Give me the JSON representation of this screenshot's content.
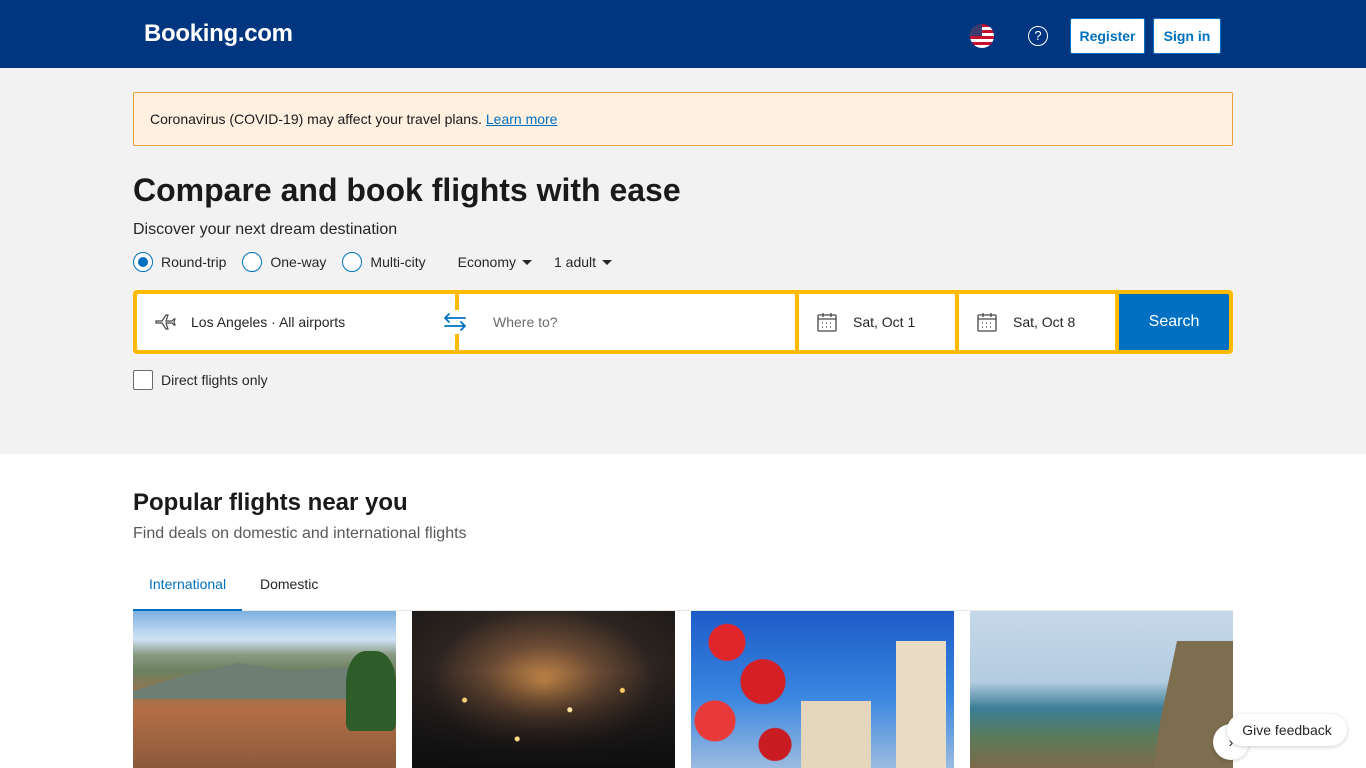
{
  "header": {
    "logo": "Booking.com",
    "help_glyph": "?",
    "register_label": "Register",
    "signin_label": "Sign in",
    "flag_icon": "us-flag-icon",
    "help_icon": "help-circle-icon"
  },
  "alert": {
    "text": "Coronavirus (COVID-19) may affect your travel plans.",
    "link": "Learn more"
  },
  "hero": {
    "title": "Compare and book flights with ease",
    "subtitle": "Discover your next dream destination"
  },
  "trip_options": {
    "types": [
      {
        "label": "Round-trip",
        "selected": true
      },
      {
        "label": "One-way",
        "selected": false
      },
      {
        "label": "Multi-city",
        "selected": false
      }
    ],
    "cabin": "Economy",
    "travelers": "1 adult"
  },
  "search": {
    "from": "Los Angeles · All airports",
    "to_placeholder": "Where to?",
    "depart": "Sat, Oct 1",
    "return": "Sat, Oct 8",
    "button": "Search"
  },
  "direct_only": {
    "label": "Direct flights only",
    "checked": false
  },
  "popular": {
    "title": "Popular flights near you",
    "subtitle": "Find deals on domestic and international flights",
    "tabs": [
      {
        "label": "International",
        "active": true
      },
      {
        "label": "Domestic",
        "active": false
      }
    ]
  },
  "feedback": {
    "label": "Give feedback",
    "glyph": "›"
  },
  "colors": {
    "brand_dark": "#003580",
    "accent": "#0071c2",
    "search_border": "#febb02",
    "alert_bg": "#fff0e0"
  }
}
